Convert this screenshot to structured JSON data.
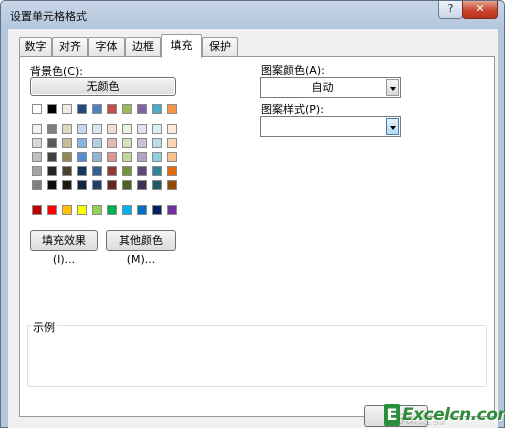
{
  "window": {
    "title": "设置单元格格式",
    "help_label": "?",
    "close_label": "✕"
  },
  "tabs": [
    "数字",
    "对齐",
    "字体",
    "边框",
    "填充",
    "保护"
  ],
  "active_tab": "填充",
  "fill": {
    "background_label": "背景色(C):",
    "no_color_label": "无颜色",
    "fill_effects_label": "填充效果(I)...",
    "more_colors_label": "其他颜色(M)...",
    "pattern_color_label": "图案颜色(A):",
    "pattern_color_value": "自动",
    "pattern_style_label": "图案样式(P):",
    "pattern_style_value": "",
    "sample_label": "示例"
  },
  "palette": {
    "theme_top": [
      "#ffffff",
      "#000000",
      "#eeece1",
      "#1f497d",
      "#4f81bd",
      "#c0504d",
      "#9bbb59",
      "#8064a2",
      "#4bacc6",
      "#f79646"
    ],
    "theme_shades": [
      [
        "#f2f2f2",
        "#808080",
        "#ddd9c3",
        "#c6d9f0",
        "#dbe5f1",
        "#f2dcdb",
        "#ebf1dd",
        "#e5e0ec",
        "#dbeef3",
        "#fdeada"
      ],
      [
        "#d9d9d9",
        "#595959",
        "#c4bd97",
        "#8db3e2",
        "#b8cce4",
        "#e5b9b7",
        "#d7e3bc",
        "#ccc1d9",
        "#b7dde8",
        "#fbd5b5"
      ],
      [
        "#bfbfbf",
        "#404040",
        "#938953",
        "#548dd4",
        "#95b3d7",
        "#d99694",
        "#c3d69b",
        "#b2a2c7",
        "#92cddc",
        "#fac08f"
      ],
      [
        "#a6a6a6",
        "#262626",
        "#494429",
        "#17365d",
        "#366092",
        "#953734",
        "#76923c",
        "#5f497a",
        "#31859b",
        "#e36c09"
      ],
      [
        "#808080",
        "#0d0d0d",
        "#1d1b10",
        "#0f243e",
        "#244061",
        "#632423",
        "#4f6128",
        "#3f3151",
        "#205867",
        "#974806"
      ]
    ],
    "standard": [
      "#c00000",
      "#ff0000",
      "#ffc000",
      "#ffff00",
      "#92d050",
      "#00b050",
      "#00b0f0",
      "#0070c0",
      "#002060",
      "#7030a0"
    ]
  },
  "footer": {
    "watermark_text": "Excelcn.com",
    "watermark_letter": "E",
    "baidu_text": "Bai经验"
  }
}
